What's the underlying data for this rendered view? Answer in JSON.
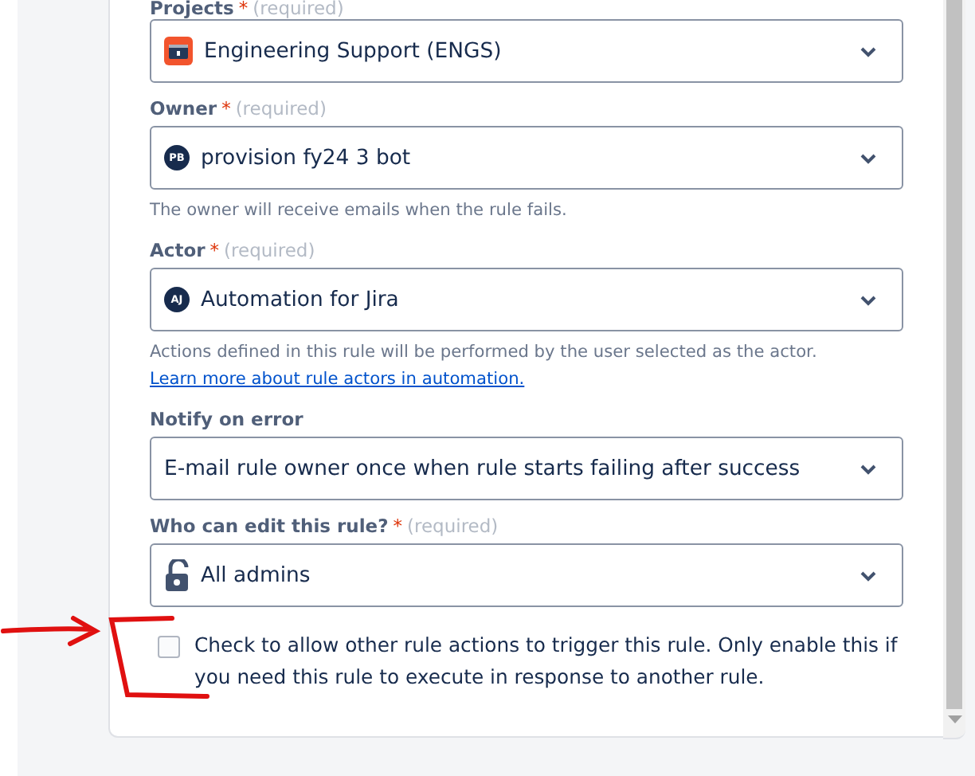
{
  "fields": [
    {
      "label": "Projects",
      "required_mark": "*",
      "required_hint": "(required)",
      "value": "Engineering Support (ENGS)",
      "kind": "project"
    },
    {
      "label": "Owner",
      "required_mark": "*",
      "required_hint": "(required)",
      "value": "provision fy24 3 bot",
      "kind": "user",
      "initials": "PB",
      "helper": "The owner will receive emails when the rule fails."
    },
    {
      "label": "Actor",
      "required_mark": "*",
      "required_hint": "(required)",
      "value": "Automation for Jira",
      "kind": "user",
      "initials": "AJ",
      "helper": "Actions defined in this rule will be performed by the user selected as the actor.",
      "helper_link": "Learn more about rule actors in automation."
    },
    {
      "label": "Notify on error",
      "value": "E-mail rule owner once when rule starts failing after success",
      "kind": "plain"
    },
    {
      "label": "Who can edit this rule?",
      "required_mark": "*",
      "required_hint": "(required)",
      "value": "All admins",
      "kind": "permission"
    }
  ],
  "checkbox": {
    "checked": false,
    "text": "Check to allow other rule actions to trigger this rule. Only enable this if you need this rule to execute in response to another rule."
  }
}
